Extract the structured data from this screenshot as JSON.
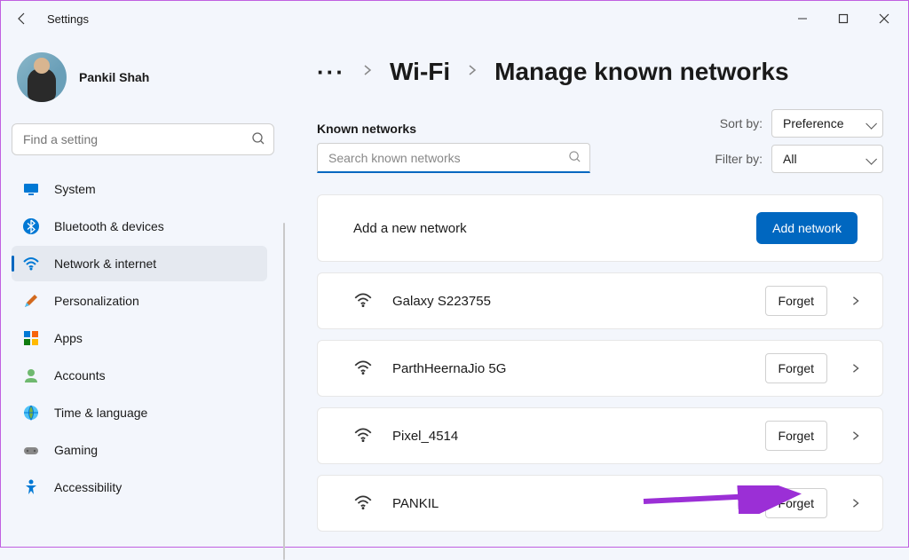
{
  "window": {
    "title": "Settings"
  },
  "user": {
    "name": "Pankil Shah"
  },
  "sidebar": {
    "find_placeholder": "Find a setting",
    "items": [
      {
        "label": "System"
      },
      {
        "label": "Bluetooth & devices"
      },
      {
        "label": "Network & internet"
      },
      {
        "label": "Personalization"
      },
      {
        "label": "Apps"
      },
      {
        "label": "Accounts"
      },
      {
        "label": "Time & language"
      },
      {
        "label": "Gaming"
      },
      {
        "label": "Accessibility"
      }
    ],
    "active_index": 2
  },
  "breadcrumbs": {
    "more": "···",
    "wifi": "Wi-Fi",
    "current": "Manage known networks"
  },
  "known": {
    "heading": "Known networks",
    "search_placeholder": "Search known networks"
  },
  "filters": {
    "sort_label": "Sort by:",
    "sort_value": "Preference",
    "filter_label": "Filter by:",
    "filter_value": "All"
  },
  "addnet": {
    "text": "Add a new network",
    "button": "Add network"
  },
  "networks": [
    {
      "name": "Galaxy S223755",
      "forget": "Forget"
    },
    {
      "name": "ParthHeernaJio 5G",
      "forget": "Forget"
    },
    {
      "name": "Pixel_4514",
      "forget": "Forget"
    },
    {
      "name": "PANKIL",
      "forget": "Forget"
    }
  ],
  "colors": {
    "accent": "#0067c0",
    "arrow": "#9b2fd6"
  }
}
